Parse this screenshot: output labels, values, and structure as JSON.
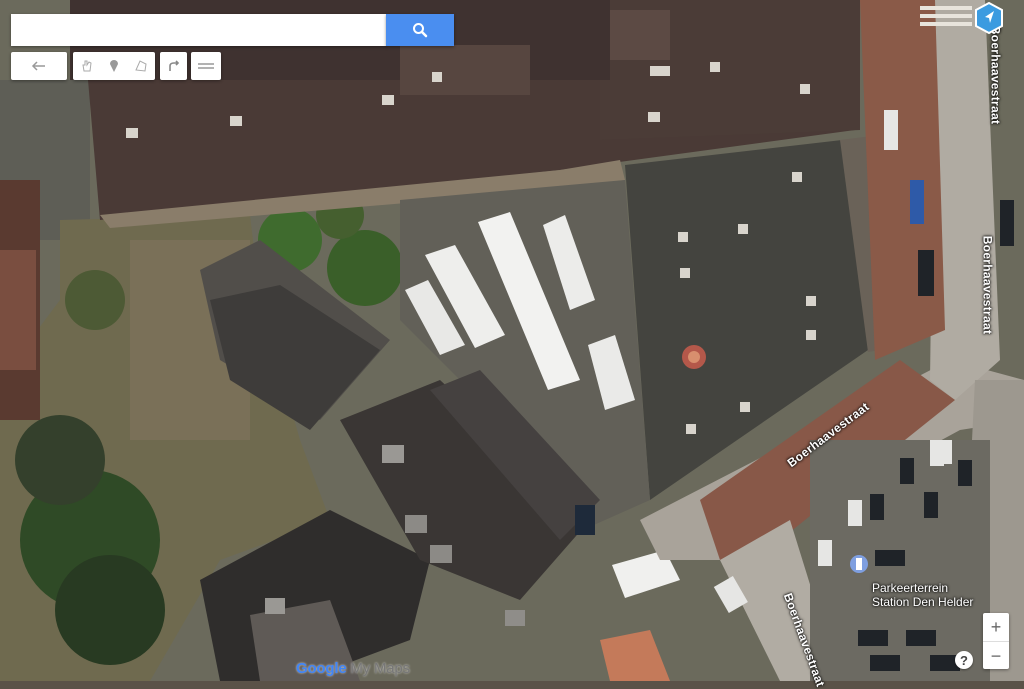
{
  "search": {
    "placeholder": "",
    "value": ""
  },
  "toolbar": {
    "tools": [
      {
        "name": "undo-icon"
      },
      {
        "name": "hand-icon"
      },
      {
        "name": "marker-icon"
      },
      {
        "name": "polygon-icon"
      },
      {
        "name": "route-icon"
      },
      {
        "name": "ruler-icon"
      }
    ]
  },
  "map": {
    "streets": [
      "Boerhaavestraat",
      "Boerhaavestraat",
      "Boerhaavestraat",
      "Boerhaavestraat",
      "Boerhaavestraat"
    ],
    "poi": {
      "line1": "Parkeerterrein",
      "line2": "Station Den Helder"
    },
    "view": "satellite"
  },
  "zoom": {
    "in": "+",
    "out": "−"
  },
  "help": "?",
  "branding": {
    "google": "Google",
    "mymaps": " My Maps"
  },
  "colors": {
    "accent": "#4a8ef0",
    "nav": "#3b9be0"
  }
}
